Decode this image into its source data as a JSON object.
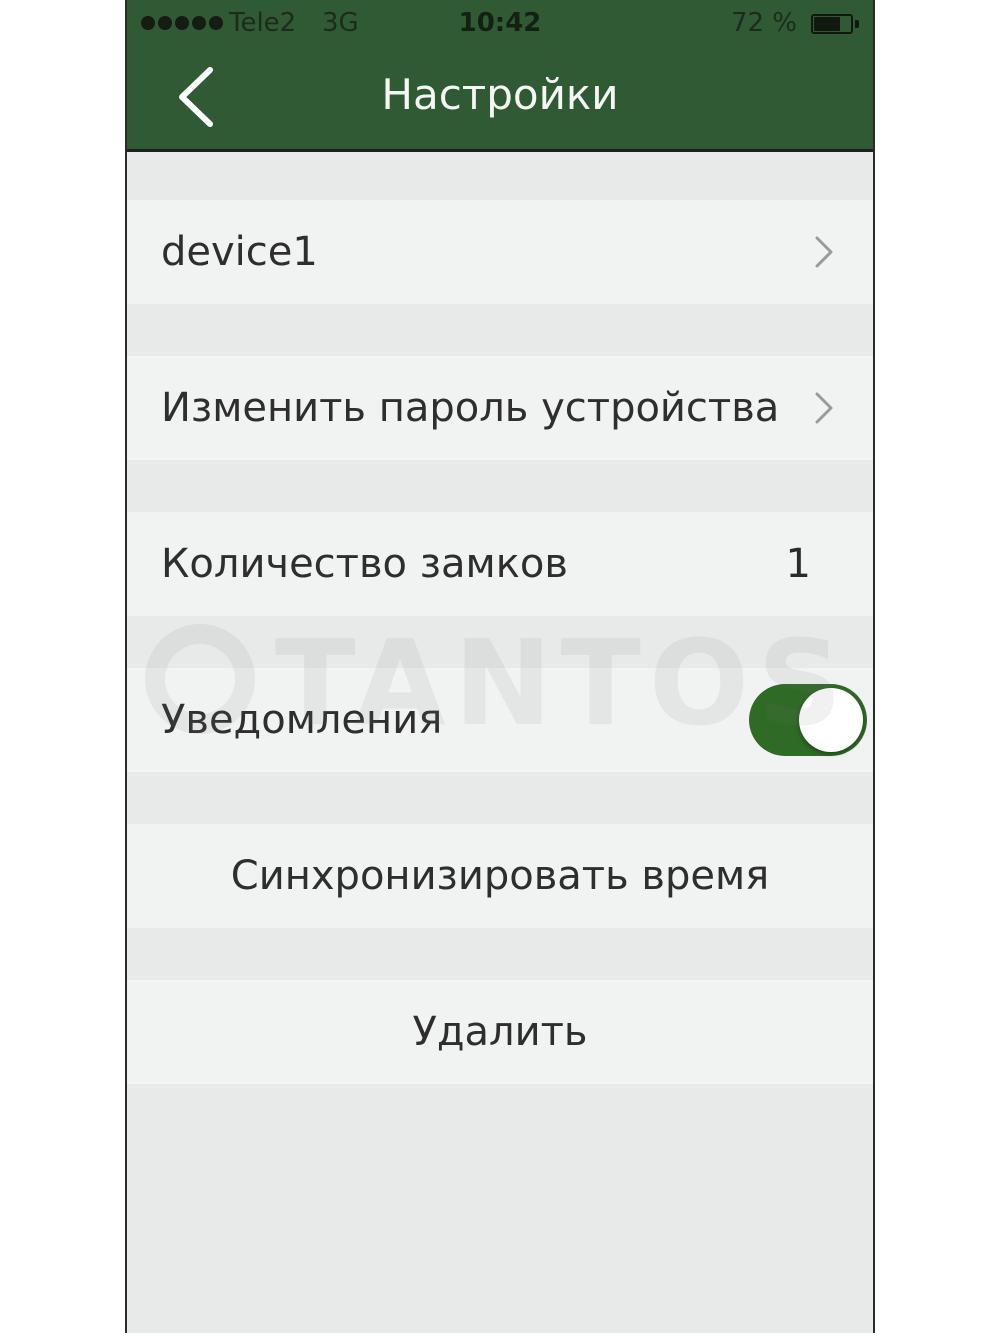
{
  "status_bar": {
    "carrier": "Tele2",
    "network": "3G",
    "time": "10:42",
    "battery_percent_text": "72 %",
    "battery_level": 0.72
  },
  "header": {
    "title": "Настройки",
    "background_color": "#2f5a33"
  },
  "rows": {
    "device_name": "device1",
    "change_password": "Изменить пароль устройства",
    "lock_count_label": "Количество замков",
    "lock_count_value": "1",
    "notifications_label": "Уведомления",
    "notifications_enabled": true,
    "sync_time": "Синхронизировать время",
    "delete": "Удалить"
  },
  "watermark": {
    "text": "TANTOS"
  },
  "colors": {
    "toggle_on": "#2f6a26",
    "row_background": "#f1f3f2",
    "group_background": "#e7eae8"
  },
  "icons": {
    "back": "chevron-left-icon",
    "disclosure": "chevron-right-icon"
  }
}
